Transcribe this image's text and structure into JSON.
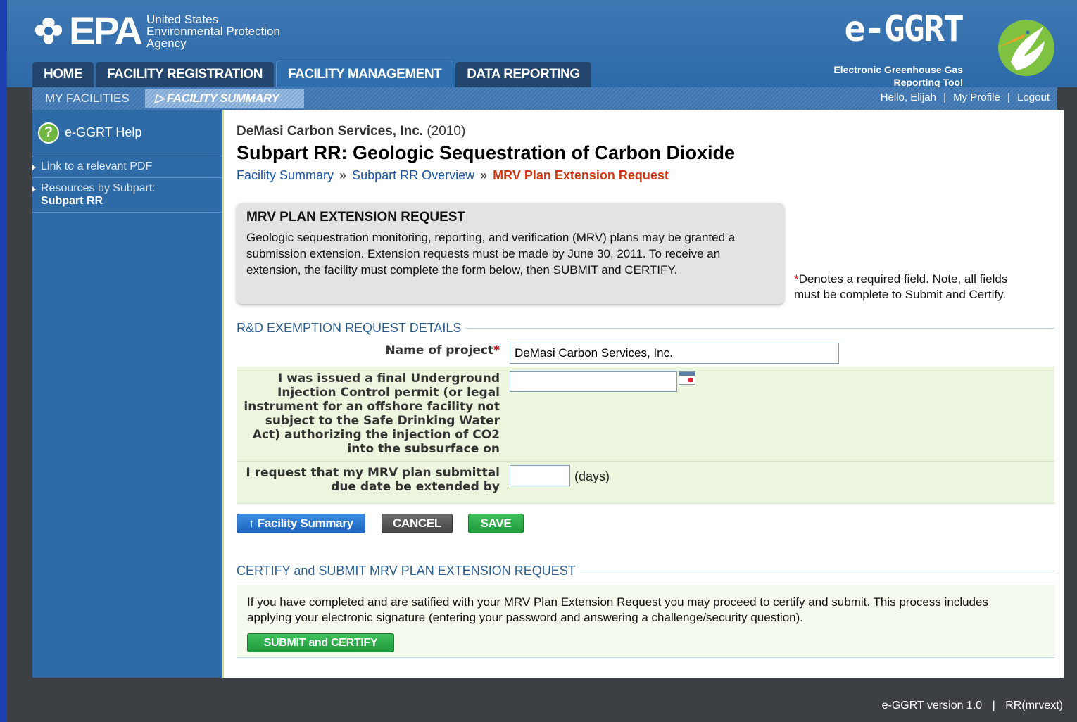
{
  "header": {
    "epa_logo_text": "EPA",
    "epa_agency": [
      "United States",
      "Environmental Protection",
      "Agency"
    ],
    "eggrt_title": "e-GGRT",
    "eggrt_subtitle": [
      "Electronic Greenhouse Gas",
      "Reporting Tool"
    ]
  },
  "nav": {
    "tabs": [
      {
        "label": "HOME",
        "active": false
      },
      {
        "label": "FACILITY REGISTRATION",
        "active": false
      },
      {
        "label": "FACILITY MANAGEMENT",
        "active": true
      },
      {
        "label": "DATA REPORTING",
        "active": false
      }
    ]
  },
  "subnav": {
    "my_facilities": "MY FACILITIES",
    "facility_summary": "FACILITY SUMMARY",
    "greeting": "Hello, Elijah",
    "separator": "|",
    "my_profile": "My Profile",
    "logout": "Logout"
  },
  "sidebar": {
    "help_label": "e-GGRT Help",
    "links": [
      {
        "label": "Link to a relevant PDF",
        "sub": ""
      },
      {
        "label": "Resources by Subpart:",
        "sub": "Subpart RR"
      }
    ]
  },
  "main": {
    "facility_name": "DeMasi Carbon Services, Inc.",
    "facility_year": "(2010)",
    "page_title": "Subpart RR: Geologic Sequestration of Carbon Dioxide",
    "breadcrumb": {
      "item1": "Facility Summary",
      "sep": "»",
      "item2": "Subpart RR Overview",
      "current": "MRV Plan Extension Request"
    },
    "info_box": {
      "title": "MRV PLAN EXTENSION REQUEST",
      "text": "Geologic sequestration monitoring, reporting, and verification (MRV) plans may be granted a submission extension. Extension requests must be made by June 30, 2011. To receive an extension, the facility must complete the form below, then SUBMIT and CERTIFY."
    },
    "required_note": {
      "star": "*",
      "line1": "Denotes a required field. Note, all fields",
      "line2": "must be complete to Submit and Certify."
    },
    "details_section_title": "R&D EXEMPTION REQUEST DETAILS",
    "form": {
      "project_label": "Name of project",
      "required_star": "*",
      "project_value": "DeMasi Carbon Services, Inc.",
      "permit_label": "I was issued a final Underground Injection Control permit (or legal instrument for an offshore facility not subject to the Safe Drinking Water Act) authorizing the injection of CO2 into the subsurface on",
      "permit_value": "",
      "extend_label": "I request that my MRV plan submittal due date be extended by",
      "extend_value": "",
      "days_unit": "(days)"
    },
    "buttons": {
      "facility_summary": "↑ Facility Summary",
      "cancel": "CANCEL",
      "save": "SAVE"
    },
    "certify_section_title": "CERTIFY and SUBMIT MRV PLAN EXTENSION REQUEST",
    "certify_text": "If you have completed and are satified with your MRV Plan Extension Request you may proceed to certify and submit. This process includes applying your electronic signature (entering your password and answering a challenge/security question).",
    "submit_button": "SUBMIT and CERTIFY"
  },
  "footer": {
    "version": "e-GGRT version 1.0",
    "separator": "|",
    "code": "RR(mrvext)"
  },
  "colors": {
    "header_blue": "#2d6aa8",
    "accent_red": "#cc3a14",
    "link_blue": "#1a55a8",
    "save_green": "#1f9a3a"
  }
}
